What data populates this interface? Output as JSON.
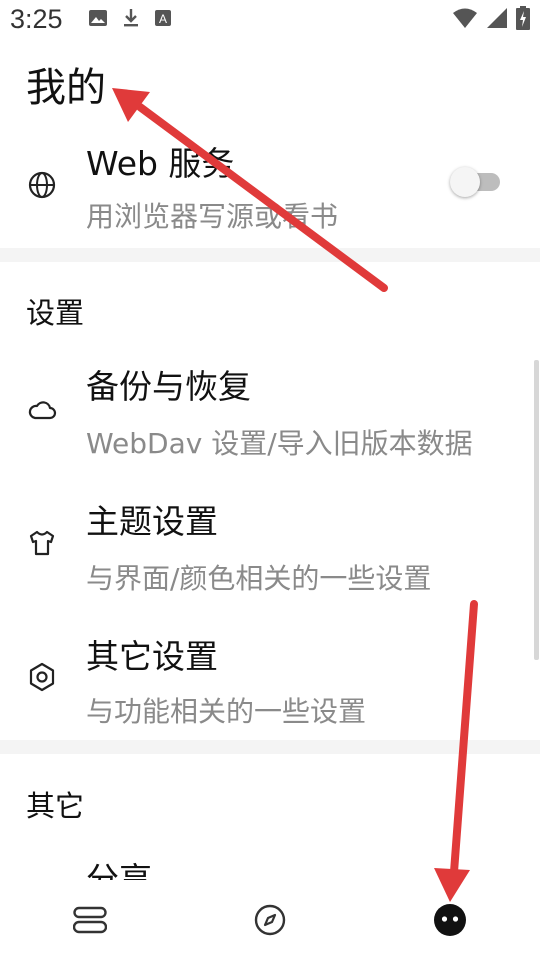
{
  "status_bar": {
    "time": "3:25",
    "left_icons": [
      "image-icon",
      "download-icon",
      "text-a-icon"
    ],
    "right_icons": [
      "wifi-icon",
      "signal-icon",
      "battery-icon"
    ]
  },
  "page": {
    "title": "我的"
  },
  "web_service": {
    "icon": "globe-icon",
    "title": "Web 服务",
    "subtitle": "用浏览器写源或看书",
    "toggle_on": false
  },
  "settings_section": {
    "header": "设置",
    "items": [
      {
        "icon": "cloud-icon",
        "title": "备份与恢复",
        "subtitle": "WebDav 设置/导入旧版本数据"
      },
      {
        "icon": "shirt-icon",
        "title": "主题设置",
        "subtitle": "与界面/颜色相关的一些设置"
      },
      {
        "icon": "settings-hexagon-icon",
        "title": "其它设置",
        "subtitle": "与功能相关的一些设置"
      }
    ]
  },
  "other_section": {
    "header": "其它",
    "items": [
      {
        "title": "分享"
      }
    ]
  },
  "bottom_nav": {
    "items": [
      {
        "icon": "bookshelf-icon",
        "active": false
      },
      {
        "icon": "compass-icon",
        "active": false
      },
      {
        "icon": "profile-face-icon",
        "active": true
      }
    ]
  },
  "colors": {
    "annotation_arrow": "#e03a3a",
    "subtitle_text": "#8a8a8a",
    "section_gap": "#f4f4f4"
  }
}
